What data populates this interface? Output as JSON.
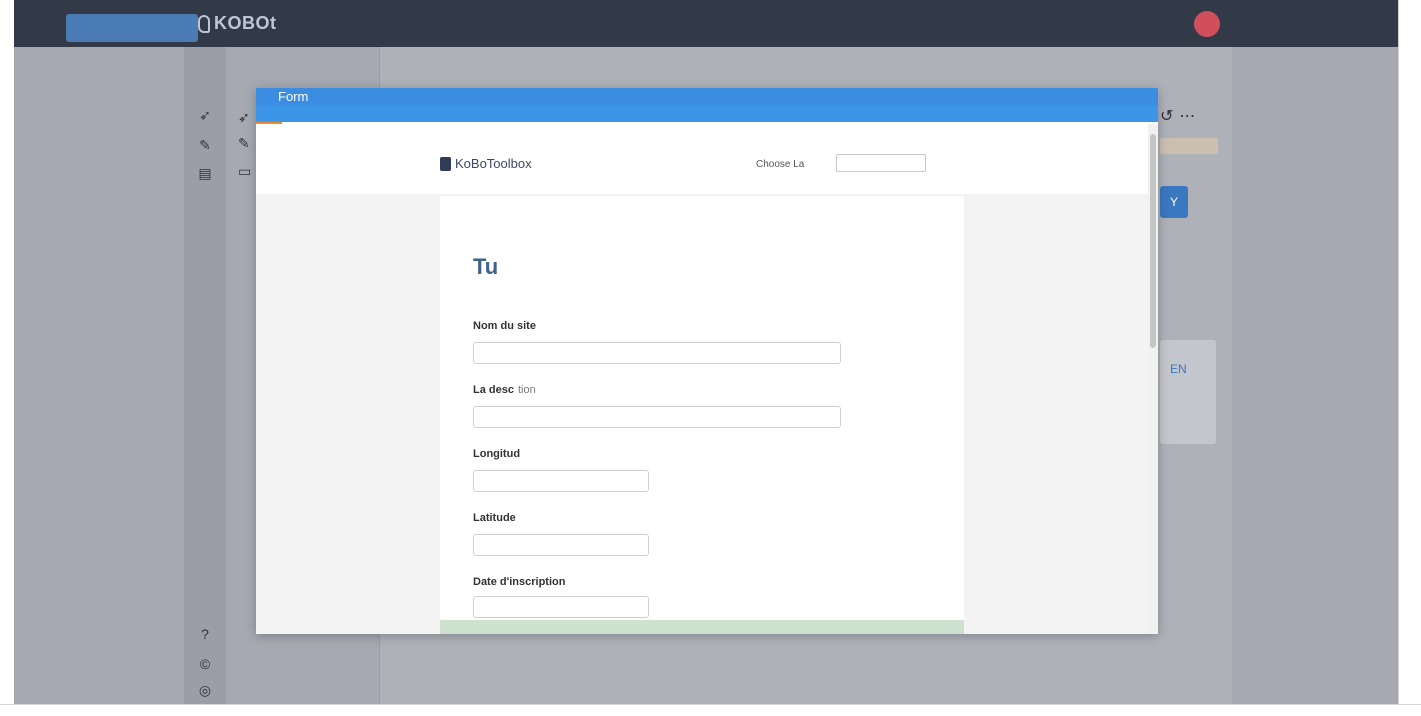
{
  "app": {
    "logo_text": "KOBOt"
  },
  "modal": {
    "title": "Form",
    "brand": "KoBoToolbox",
    "language_label": "Choose La",
    "form_title": "Tu",
    "questions": [
      {
        "label": "Nom du site",
        "hint": ""
      },
      {
        "label": "La desc",
        "hint": "tion"
      },
      {
        "label": "Longitud",
        "hint": ""
      },
      {
        "label": "Latitude",
        "hint": ""
      },
      {
        "label": "Date d'inscription",
        "hint": ""
      }
    ]
  },
  "side_panel": {
    "button_glyph": "Y",
    "card_text": "EN"
  },
  "icons": {
    "sidebar": [
      "rocket-icon",
      "edit-icon",
      "archive-icon"
    ],
    "footer": [
      "help-icon",
      "copyright-icon",
      "github-icon"
    ],
    "content_actions": [
      "share-icon",
      "more-icon"
    ]
  },
  "colors": {
    "topbar": "#333a47",
    "modal_header": "#3a8de0",
    "accent": "#e98c32",
    "form_title": "#41628a"
  }
}
